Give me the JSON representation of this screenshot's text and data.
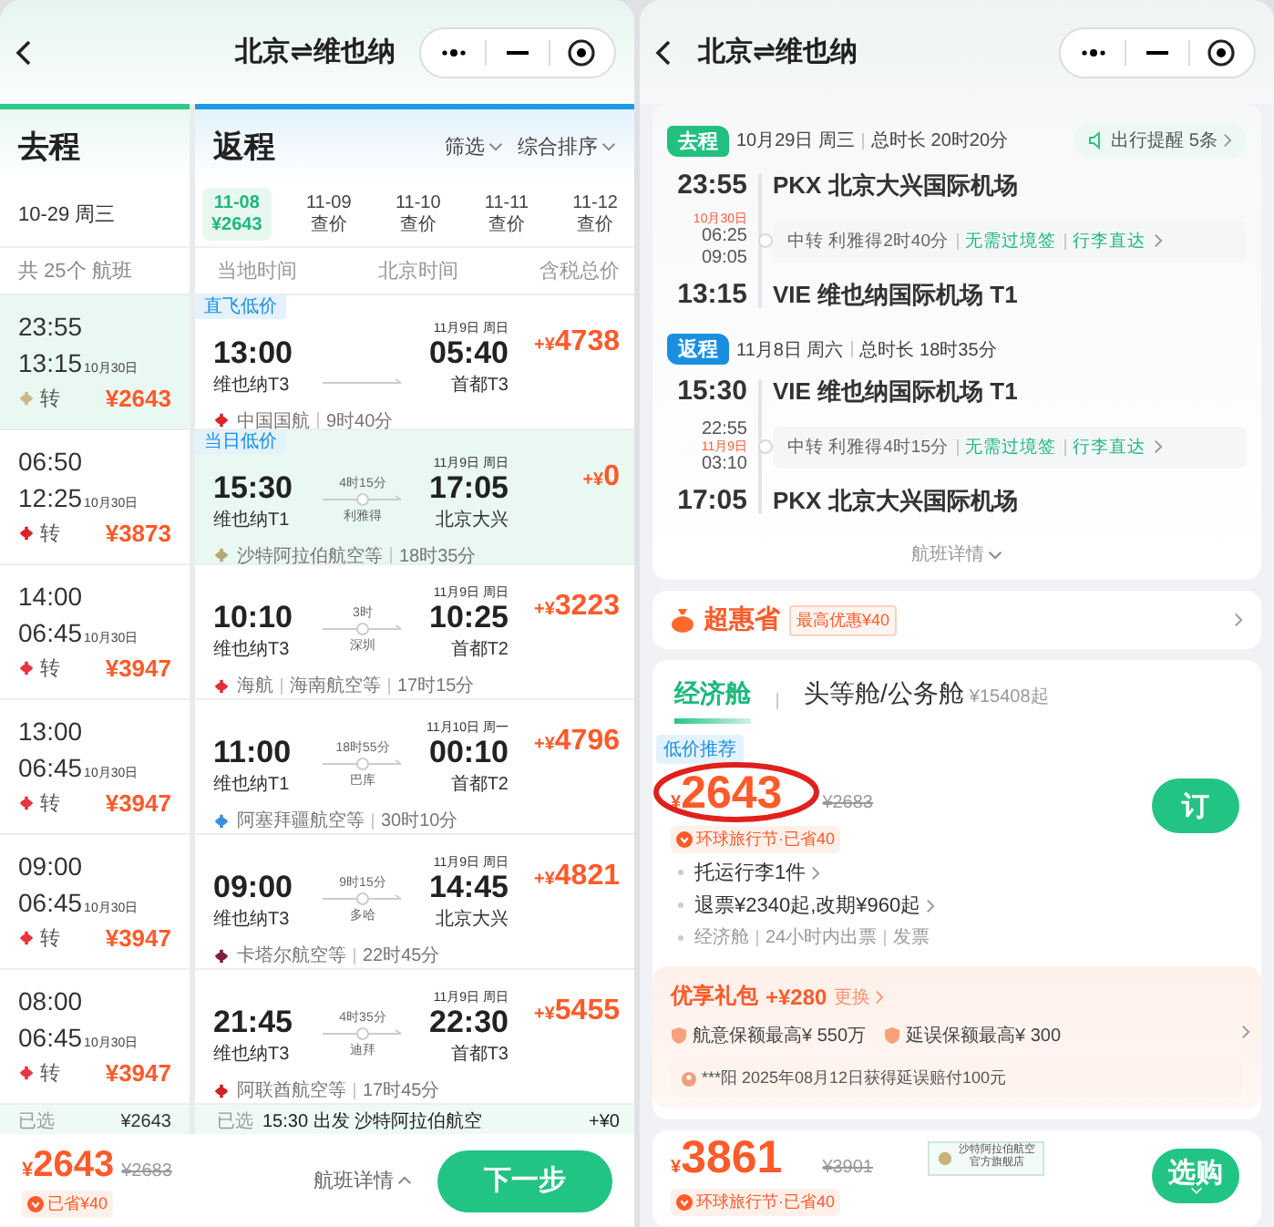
{
  "left": {
    "nav": {
      "title": "北京⇌维也纳"
    },
    "outbound": {
      "label": "去程",
      "date": "10-29 周三",
      "count": "共 25个 航班",
      "footer_label": "已选",
      "footer_price": "¥2643",
      "flights": [
        {
          "depart": "23:55",
          "arrive": "13:15",
          "arrive_date": "10月30日",
          "stop": "转",
          "price": "¥2643",
          "color": "#c9b98a",
          "selected": true
        },
        {
          "depart": "06:50",
          "arrive": "12:25",
          "arrive_date": "10月30日",
          "stop": "转",
          "price": "¥3873",
          "color": "#d6262b",
          "selected": false
        },
        {
          "depart": "14:00",
          "arrive": "06:45",
          "arrive_date": "10月30日",
          "stop": "转",
          "price": "¥3947",
          "color": "#e8353f",
          "selected": false
        },
        {
          "depart": "13:00",
          "arrive": "06:45",
          "arrive_date": "10月30日",
          "stop": "转",
          "price": "¥3947",
          "color": "#e8353f",
          "selected": false
        },
        {
          "depart": "09:00",
          "arrive": "06:45",
          "arrive_date": "10月30日",
          "stop": "转",
          "price": "¥3947",
          "color": "#e8353f",
          "selected": false
        },
        {
          "depart": "08:00",
          "arrive": "06:45",
          "arrive_date": "10月30日",
          "stop": "转",
          "price": "¥3947",
          "color": "#e8353f",
          "selected": false
        }
      ]
    },
    "return": {
      "label": "返程",
      "filters": [
        "筛选",
        "综合排序"
      ],
      "dates": [
        {
          "date": "11-08",
          "price": "¥2643",
          "selected": true
        },
        {
          "date": "11-09",
          "price": "查价",
          "selected": false
        },
        {
          "date": "11-10",
          "price": "查价",
          "selected": false
        },
        {
          "date": "11-11",
          "price": "查价",
          "selected": false
        },
        {
          "date": "11-12",
          "price": "查价",
          "selected": false
        }
      ],
      "headings": [
        "当地时间",
        "北京时间",
        "含税总价"
      ],
      "flights": [
        {
          "tag": "直飞低价",
          "depart": "13:00",
          "from": "维也纳T3",
          "arrive_date": "11月9日 周日",
          "arrive": "05:40",
          "to": "首都T3",
          "currency": "+¥",
          "amount": "4738",
          "airlines": [
            "中国国航"
          ],
          "total": "9时40分",
          "color": "#d9262c",
          "selected": false
        },
        {
          "tag": "当日低价",
          "depart": "15:30",
          "from": "维也纳T1",
          "duration": "4时15分",
          "via": "利雅得",
          "arrive_date": "11月9日 周日",
          "arrive": "17:05",
          "to": "北京大兴",
          "currency": "+¥",
          "amount": "0",
          "airlines": [
            "沙特阿拉伯航空等"
          ],
          "total": "18时35分",
          "color": "#b8a878",
          "selected": true
        },
        {
          "depart": "10:10",
          "from": "维也纳T3",
          "duration": "3时",
          "via": "深圳",
          "arrive_date": "11月9日 周日",
          "arrive": "10:25",
          "to": "首都T2",
          "currency": "+¥",
          "amount": "3223",
          "airlines": [
            "海航",
            "海南航空等"
          ],
          "total": "17时15分",
          "color": "#e0323c",
          "selected": false
        },
        {
          "depart": "11:00",
          "from": "维也纳T1",
          "duration": "18时55分",
          "via": "巴库",
          "arrive_date": "11月10日 周一",
          "arrive": "00:10",
          "to": "首都T2",
          "currency": "+¥",
          "amount": "4796",
          "airlines": [
            "阿塞拜疆航空等"
          ],
          "total": "30时10分",
          "color": "#3a8fd8",
          "selected": false
        },
        {
          "depart": "09:00",
          "from": "维也纳T3",
          "duration": "9时15分",
          "via": "多哈",
          "arrive_date": "11月9日 周日",
          "arrive": "14:45",
          "to": "北京大兴",
          "currency": "+¥",
          "amount": "4821",
          "airlines": [
            "卡塔尔航空等"
          ],
          "total": "22时45分",
          "color": "#7a1f3d",
          "selected": false
        },
        {
          "depart": "21:45",
          "from": "维也纳T3",
          "duration": "4时35分",
          "via": "迪拜",
          "arrive_date": "11月9日 周日",
          "arrive": "22:30",
          "to": "首都T3",
          "currency": "+¥",
          "amount": "5455",
          "airlines": [
            "阿联酋航空等"
          ],
          "total": "17时45分",
          "color": "#d0202a",
          "selected": false
        }
      ],
      "footer": {
        "label": "已选",
        "text": "15:30 出发 沙特阿拉伯航空",
        "price": "+¥0"
      }
    },
    "bottom": {
      "currency": "¥",
      "amount": "2643",
      "original": "¥2683",
      "saving": "已省¥40",
      "details": "航班详情",
      "next": "下一步"
    }
  },
  "right": {
    "nav": {
      "title": "北京⇌维也纳"
    },
    "legs": [
      {
        "kind": "outbound",
        "badge": "去程",
        "date": "10月29日 周三",
        "total": "总时长 20时20分",
        "reminder": "出行提醒 5条",
        "depart_time": "23:55",
        "depart_airport": "PKX 北京大兴国际机场",
        "stop_times": [
          {
            "kind": "date",
            "text": "10月30日"
          },
          {
            "kind": "time",
            "text": "06:25"
          },
          {
            "kind": "time",
            "text": "09:05"
          }
        ],
        "stop_text": "中转 利雅得2时40分",
        "stop_tags": [
          "无需过境签",
          "行李直达"
        ],
        "arrive_time": "13:15",
        "arrive_airport": "VIE 维也纳国际机场 T1"
      },
      {
        "kind": "return",
        "badge": "返程",
        "date": "11月8日 周六",
        "total": "总时长 18时35分",
        "depart_time": "15:30",
        "depart_airport": "VIE 维也纳国际机场 T1",
        "stop_times": [
          {
            "kind": "time",
            "text": "22:55"
          },
          {
            "kind": "date",
            "text": "11月9日"
          },
          {
            "kind": "time",
            "text": "03:10"
          }
        ],
        "stop_text": "中转 利雅得4时15分",
        "stop_tags": [
          "无需过境签",
          "行李直达"
        ],
        "arrive_time": "17:05",
        "arrive_airport": "PKX 北京大兴国际机场"
      }
    ],
    "details": "航班详情",
    "promo": {
      "title": "超惠省",
      "badge": "最高优惠¥40"
    },
    "cabins": [
      {
        "label": "经济舱",
        "selected": true
      },
      {
        "label": "头等舱/公务舱",
        "note": "¥15408起",
        "selected": false
      }
    ],
    "offers": [
      {
        "tag": "低价推荐",
        "currency": "¥",
        "amount": "2643",
        "original": "¥2683",
        "circled": true,
        "saving": "环球旅行节·已省40",
        "button": "订",
        "features": [
          {
            "kind": "link",
            "text": "托运行李1件"
          },
          {
            "kind": "link",
            "text": "退票¥2340起,改期¥960起"
          },
          {
            "kind": "plain",
            "parts": [
              "经济舱",
              "24小时内出票",
              "发票"
            ]
          }
        ],
        "gift": {
          "title": "优享礼包",
          "amount": "+¥280",
          "action": "更换",
          "items": [
            "航意保额最高¥ 550万",
            "延误保额最高¥ 300"
          ],
          "notice": "***阳 2025年08月12日获得延误赔付100元"
        }
      },
      {
        "currency": "¥",
        "amount": "3861",
        "original": "¥3901",
        "circled": false,
        "brand": [
          "沙特阿拉伯航空",
          "官方旗舰店"
        ],
        "saving": "环球旅行节·已省40",
        "button": "选购"
      }
    ]
  }
}
